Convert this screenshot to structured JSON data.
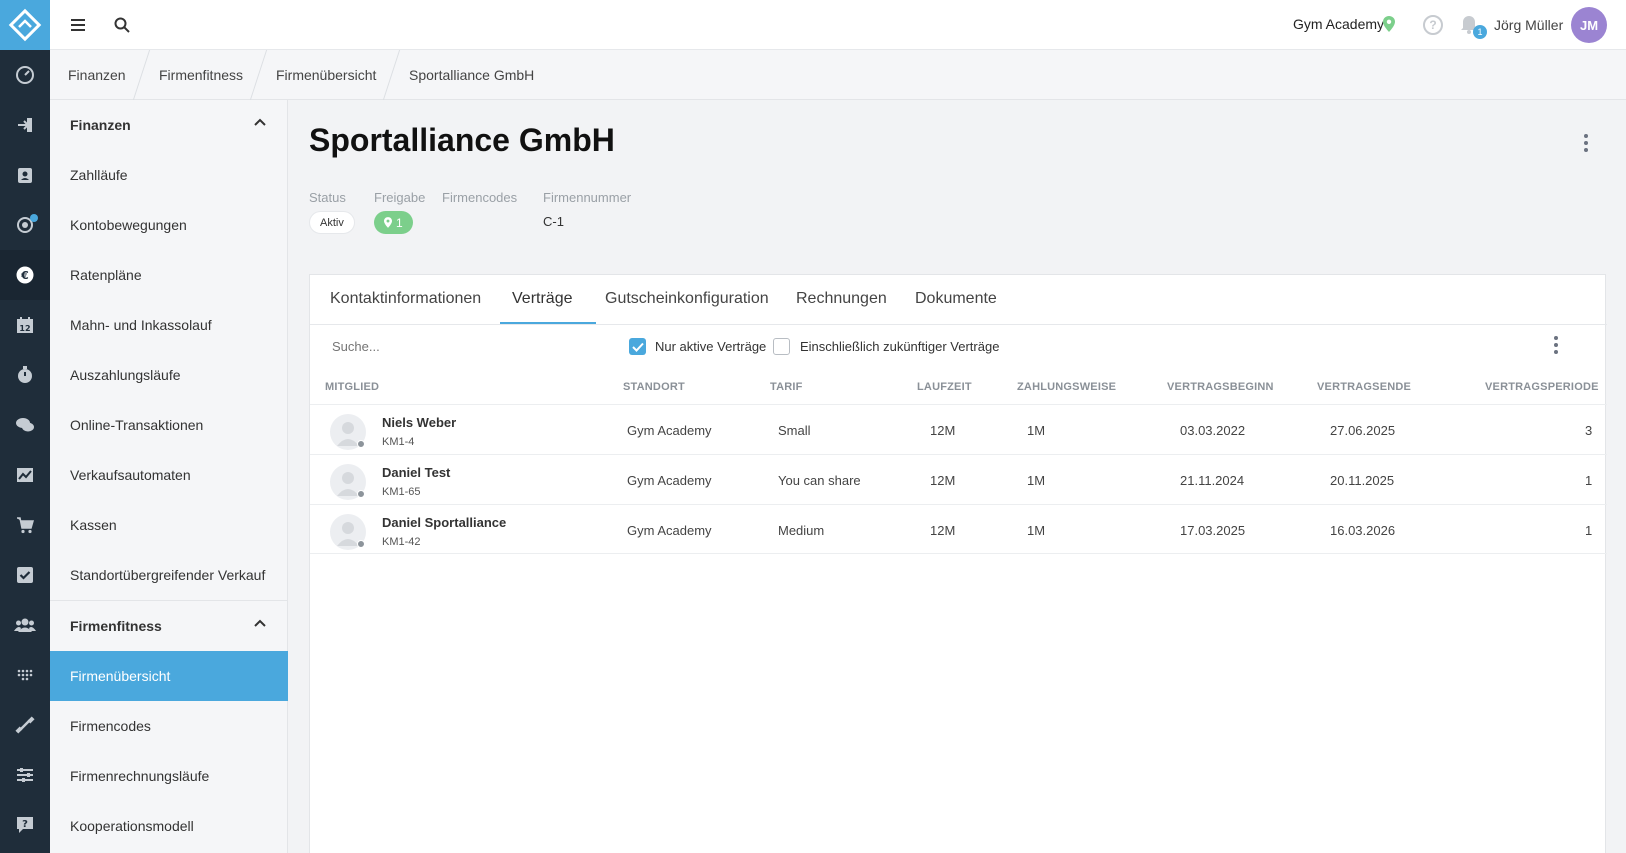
{
  "header": {
    "location": "Gym Academy",
    "notification_count": "1",
    "user_name": "Jörg Müller",
    "user_initials": "JM",
    "help_glyph": "?"
  },
  "breadcrumb": [
    "Finanzen",
    "Firmenfitness",
    "Firmenübersicht",
    "Sportalliance GmbH"
  ],
  "sidebar": {
    "section1_title": "Finanzen",
    "section1_items": [
      "Zahlläufe",
      "Kontobewegungen",
      "Ratenpläne",
      "Mahn- und Inkassolauf",
      "Auszahlungsläufe",
      "Online-Transaktionen",
      "Verkaufsautomaten",
      "Kassen",
      "Standortübergreifender Verkauf"
    ],
    "section2_title": "Firmenfitness",
    "section2_items": [
      "Firmenübersicht",
      "Firmencodes",
      "Firmenrechnungsläufe",
      "Kooperationsmodell"
    ],
    "active_item": "Firmenübersicht"
  },
  "page": {
    "title": "Sportalliance GmbH",
    "labels": {
      "status": "Status",
      "freigabe": "Freigabe",
      "firmencodes": "Firmencodes",
      "firmennummer": "Firmennummer"
    },
    "status_value": "Aktiv",
    "freigabe_value": "1",
    "firmennummer_value": "C-1"
  },
  "tabs": [
    "Kontaktinformationen",
    "Verträge",
    "Gutscheinkonfiguration",
    "Rechnungen",
    "Dokumente"
  ],
  "active_tab": "Verträge",
  "filters": {
    "search_placeholder": "Suche...",
    "only_active_label": "Nur aktive Verträge",
    "only_active_checked": true,
    "include_future_label": "Einschließlich zukünftiger Verträge",
    "include_future_checked": false
  },
  "table": {
    "columns": [
      "Mitglied",
      "Standort",
      "Tarif",
      "Laufzeit",
      "Zahlungsweise",
      "Vertragsbeginn",
      "Vertragsende",
      "Vertragsperiode"
    ],
    "rows": [
      {
        "name": "Niels Weber",
        "code": "KM1-4",
        "standort": "Gym Academy",
        "tarif": "Small",
        "laufzeit": "12M",
        "zahlungsweise": "1M",
        "beginn": "03.03.2022",
        "ende": "27.06.2025",
        "periode": "3"
      },
      {
        "name": "Daniel Test",
        "code": "KM1-65",
        "standort": "Gym Academy",
        "tarif": "You can share",
        "laufzeit": "12M",
        "zahlungsweise": "1M",
        "beginn": "21.11.2024",
        "ende": "20.11.2025",
        "periode": "1"
      },
      {
        "name": "Daniel Sportalliance",
        "code": "KM1-42",
        "standort": "Gym Academy",
        "tarif": "Medium",
        "laufzeit": "12M",
        "zahlungsweise": "1M",
        "beginn": "17.03.2025",
        "ende": "16.03.2026",
        "periode": "1"
      }
    ]
  },
  "colors": {
    "accent": "#4aa8dd",
    "rail": "#1f2d3a",
    "freigabe_green": "#7ccf8b",
    "avatar_purple": "#9b84d2"
  },
  "icons": {
    "rail": [
      "dashboard-icon",
      "login-icon",
      "contacts-icon",
      "target-icon",
      "euro-icon",
      "calendar-icon",
      "stopwatch-icon",
      "chat-icon",
      "chart-icon",
      "cart-icon",
      "checkbox-icon",
      "group-icon",
      "dots-grid-icon",
      "dumbbell-icon",
      "sliders-icon",
      "help-chat-icon"
    ],
    "topbar": [
      "menu-icon",
      "search-icon",
      "location-pin-icon",
      "help-icon",
      "notification-icon"
    ]
  }
}
